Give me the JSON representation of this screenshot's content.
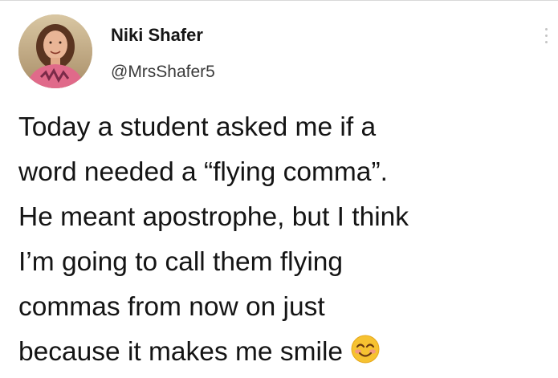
{
  "author": {
    "display_name": "Niki Shafer",
    "handle": "@MrsShafer5",
    "avatar_icon": "profile-photo-icon"
  },
  "more_menu_icon": "vertical-ellipsis-icon",
  "tweet": {
    "lines": [
      "Today a student asked me if a",
      "word needed a “flying comma”.",
      "He meant apostrophe, but I think",
      "I’m going to call them flying",
      "commas from now on just",
      "because it makes me smile"
    ],
    "emoji_icon": "smiling-face-with-smiling-eyes-icon"
  },
  "colors": {
    "text": "#141414",
    "handle": "#3a3a3a",
    "emoji": "#f6c231"
  }
}
